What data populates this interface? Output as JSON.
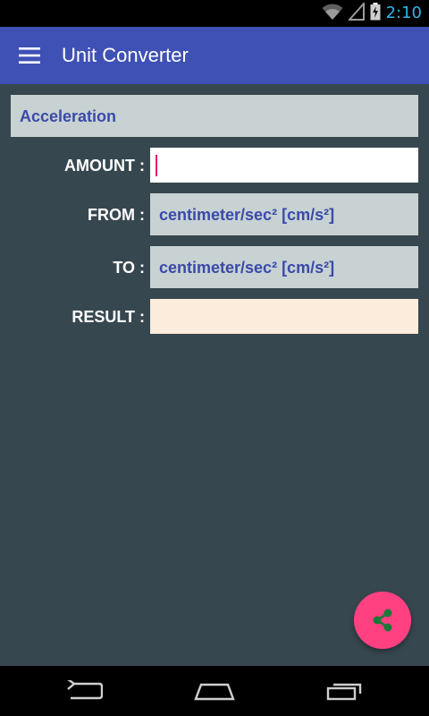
{
  "status_bar": {
    "time": "2:10",
    "icons": [
      "wifi-icon",
      "signal-icon",
      "battery-charging-icon"
    ]
  },
  "app_bar": {
    "menu_icon": "hamburger-menu-icon",
    "title": "Unit Converter"
  },
  "category": {
    "label": "Acceleration"
  },
  "form": {
    "amount_label": "AMOUNT :",
    "amount_value": "",
    "from_label": "FROM :",
    "from_value": "centimeter/sec² [cm/s²]",
    "to_label": "TO :",
    "to_value": "centimeter/sec² [cm/s²]",
    "result_label": "RESULT :",
    "result_value": ""
  },
  "fab": {
    "icon": "share-icon"
  },
  "nav_bar": {
    "icons": [
      "back-icon",
      "home-icon",
      "recents-icon"
    ]
  },
  "colors": {
    "app_bar": "#3f51b5",
    "background": "#37474f",
    "accent": "#ff4081",
    "field_text": "#3a4aa8",
    "select_bg": "#c8d2d3",
    "result_bg": "#fbecdc"
  }
}
